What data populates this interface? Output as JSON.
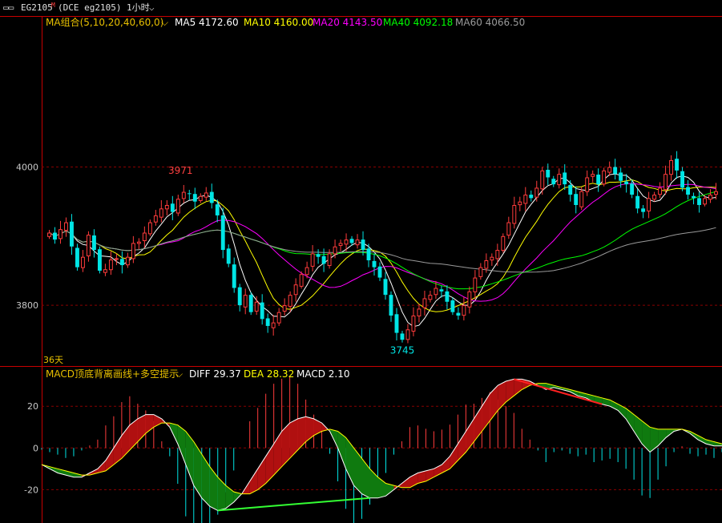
{
  "title_bar": {
    "symbol": "EG2105",
    "symbol_marker": "M",
    "contract": "(DCE eg2105)",
    "period": "1小时"
  },
  "ma_legend": {
    "label": "MA组合(5,10,20,40,60,0)",
    "ma5": "MA5 4172.60",
    "ma10": "MA10 4160.00",
    "ma20": "MA20 4143.50",
    "ma40": "MA40 4092.18",
    "ma60": "MA60 4066.50"
  },
  "macd_legend": {
    "label": "MACD顶底背离画线+多空提示",
    "diff": "DIFF 29.37",
    "dea": "DEA 28.32",
    "macd": "MACD 2.10"
  },
  "price_axis": {
    "labels": [
      "4000",
      "3800"
    ],
    "ticks": [
      4000,
      3800
    ]
  },
  "macd_axis": {
    "labels": [
      "20",
      "0",
      "-20"
    ],
    "ticks": [
      20,
      0,
      -20
    ]
  },
  "annotations": {
    "high": "3971",
    "low": "3745",
    "days": "36天"
  },
  "colors": {
    "up": "#ff3c3c",
    "down": "#00e5e5",
    "ma5": "#ffffff",
    "ma10": "#ffff00",
    "ma20": "#ff00ff",
    "ma40": "#00ff00",
    "ma60": "#9a9a9a",
    "diff": "#ffffff",
    "dea": "#ffff00",
    "frame": "#c80000"
  },
  "chart_data": {
    "type": "candlestick",
    "price_range": [
      3712,
      4200
    ],
    "closes": [
      3905,
      3895,
      3910,
      3920,
      3885,
      3855,
      3870,
      3902,
      3880,
      3850,
      3852,
      3866,
      3868,
      3858,
      3870,
      3890,
      3892,
      3905,
      3920,
      3930,
      3940,
      3945,
      3935,
      3954,
      3964,
      3961,
      3950,
      3958,
      3963,
      3948,
      3930,
      3880,
      3860,
      3825,
      3800,
      3815,
      3790,
      3805,
      3780,
      3770,
      3775,
      3790,
      3800,
      3815,
      3830,
      3845,
      3855,
      3875,
      3870,
      3860,
      3875,
      3885,
      3890,
      3895,
      3890,
      3895,
      3880,
      3865,
      3855,
      3840,
      3815,
      3785,
      3760,
      3750,
      3765,
      3785,
      3795,
      3810,
      3815,
      3825,
      3820,
      3805,
      3790,
      3785,
      3800,
      3820,
      3840,
      3855,
      3865,
      3870,
      3880,
      3900,
      3920,
      3945,
      3950,
      3960,
      3955,
      3970,
      3995,
      3985,
      3975,
      3990,
      3975,
      3960,
      3945,
      3965,
      3985,
      3990,
      3975,
      3995,
      4000,
      3990,
      3980,
      3975,
      3960,
      3940,
      3935,
      3955,
      3960,
      3970,
      3990,
      4010,
      3995,
      3970,
      3960,
      3955,
      3945,
      3955,
      3960,
      3965
    ],
    "candles_overlay_note_excluded": true,
    "diff": [
      -8,
      -10,
      -12,
      -13,
      -14,
      -14,
      -12,
      -10,
      -6,
      0,
      6,
      11,
      14,
      16,
      16,
      14,
      10,
      2,
      -8,
      -18,
      -24,
      -28,
      -30,
      -29,
      -26,
      -22,
      -16,
      -10,
      -4,
      2,
      8,
      12,
      14,
      15,
      14,
      12,
      8,
      0,
      -10,
      -18,
      -22,
      -24,
      -24,
      -23,
      -20,
      -17,
      -14,
      -12,
      -11,
      -10,
      -8,
      -4,
      2,
      8,
      14,
      20,
      26,
      30,
      32,
      33,
      33,
      32,
      30,
      28,
      29,
      28,
      27,
      25,
      24,
      22,
      21,
      20,
      18,
      14,
      8,
      2,
      -2,
      1,
      5,
      8,
      9,
      7,
      4,
      2,
      1,
      1
    ],
    "dea": [
      -8,
      -9,
      -10,
      -11,
      -12,
      -13,
      -13,
      -12,
      -11,
      -8,
      -5,
      -1,
      3,
      7,
      10,
      12,
      12,
      11,
      8,
      3,
      -3,
      -9,
      -14,
      -18,
      -21,
      -22,
      -22,
      -20,
      -17,
      -13,
      -9,
      -5,
      -1,
      3,
      6,
      8,
      9,
      8,
      5,
      0,
      -5,
      -10,
      -14,
      -17,
      -18,
      -19,
      -19,
      -17,
      -16,
      -14,
      -12,
      -10,
      -6,
      -2,
      3,
      8,
      13,
      18,
      22,
      25,
      28,
      30,
      31,
      31,
      30,
      29,
      28,
      27,
      26,
      25,
      24,
      23,
      21,
      19,
      16,
      13,
      10,
      9,
      9,
      9,
      9,
      8,
      6,
      4,
      3,
      2
    ],
    "macd_range": [
      -36,
      32
    ]
  }
}
